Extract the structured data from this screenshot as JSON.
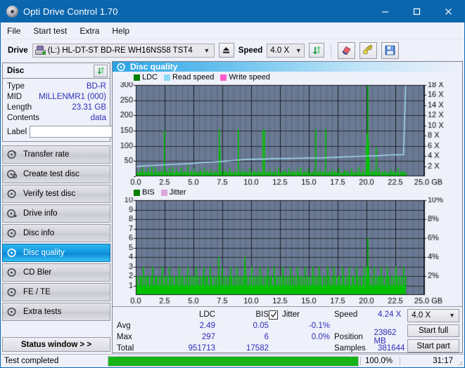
{
  "window": {
    "title": "Opti Drive Control 1.70",
    "icon": "disc-icon",
    "minimize": "minimize-icon",
    "maximize": "maximize-icon",
    "close": "close-icon"
  },
  "menu": {
    "items": [
      {
        "label": "File"
      },
      {
        "label": "Start test"
      },
      {
        "label": "Extra"
      },
      {
        "label": "Help"
      }
    ]
  },
  "toolbar": {
    "drive_label": "Drive",
    "drive_value": "(L:)  HL-DT-ST BD-RE  WH16NS58 TST4",
    "eject_icon": "eject-icon",
    "speed_label": "Speed",
    "speed_value": "4.0 X",
    "refresh_icon": "refresh-icon",
    "eraser_icon": "eraser-icon",
    "tools_icon": "wrench-icon",
    "save_icon": "save-icon"
  },
  "disc": {
    "title": "Disc",
    "refresh_icon": "refresh-icon",
    "rows": [
      {
        "key": "Type",
        "value": "BD-R"
      },
      {
        "key": "MID",
        "value": "MILLENMR1 (000)"
      },
      {
        "key": "Length",
        "value": "23.31 GB"
      },
      {
        "key": "Contents",
        "value": "data"
      }
    ],
    "label_key": "Label",
    "label_value": "",
    "label_placeholder": "",
    "disc_button_icon": "cd-icon"
  },
  "sidebar": {
    "items": [
      {
        "label": "Transfer rate",
        "icon": "disc-test-icon",
        "active": false
      },
      {
        "label": "Create test disc",
        "icon": "disc-burn-icon",
        "active": false
      },
      {
        "label": "Verify test disc",
        "icon": "disc-verify-icon",
        "active": false
      },
      {
        "label": "Drive info",
        "icon": "drive-info-icon",
        "active": false
      },
      {
        "label": "Disc info",
        "icon": "disc-info-icon",
        "active": false
      },
      {
        "label": "Disc quality",
        "icon": "disc-quality-icon",
        "active": true
      },
      {
        "label": "CD Bler",
        "icon": "cd-bler-icon",
        "active": false
      },
      {
        "label": "FE / TE",
        "icon": "fe-te-icon",
        "active": false
      },
      {
        "label": "Extra tests",
        "icon": "extra-tests-icon",
        "active": false
      }
    ],
    "status_window_label": "Status window > >"
  },
  "panel": {
    "title": "Disc quality",
    "icon": "disc-quality-icon"
  },
  "chart_data": [
    {
      "type": "line",
      "name": "ldc-chart",
      "title": "",
      "legend": [
        {
          "label": "LDC",
          "color": "#008000"
        },
        {
          "label": "Read speed",
          "color": "#8ed8f8"
        },
        {
          "label": "Write speed",
          "color": "#ff5ccc"
        }
      ],
      "legend_position": "top-left",
      "grid": true,
      "xlabel": "GB",
      "x": [
        0.0,
        2.5,
        5.0,
        7.5,
        10.0,
        12.5,
        15.0,
        17.5,
        20.0,
        22.5,
        25.0
      ],
      "xticklabels": [
        "0.0",
        "2.5",
        "5.0",
        "7.5",
        "10.0",
        "12.5",
        "15.0",
        "17.5",
        "20.0",
        "22.5",
        "25.0 GB"
      ],
      "xlim": [
        0,
        25
      ],
      "ylabel_left": "LDC",
      "yticks_left": [
        0,
        50,
        100,
        150,
        200,
        250,
        300
      ],
      "yticklabels_left": [
        "",
        "50",
        "100",
        "150",
        "200",
        "250",
        "300"
      ],
      "ylim_left": [
        0,
        300
      ],
      "ylabel_right": "Speed",
      "yticks_right": [
        2,
        4,
        6,
        8,
        10,
        12,
        14,
        16,
        18
      ],
      "yticklabels_right": [
        "2 X",
        "4 X",
        "6 X",
        "8 X",
        "10 X",
        "12 X",
        "14 X",
        "16 X",
        "18 X"
      ],
      "ylim_right": [
        0,
        18
      ],
      "series": [
        {
          "name": "LDC",
          "color": "#00c000",
          "kind": "impulse",
          "data_end_x": 23.4,
          "values": [
            8,
            14,
            6,
            10,
            22,
            7,
            12,
            9,
            30,
            11,
            7,
            18,
            9,
            13,
            6,
            26,
            10,
            8,
            15,
            34,
            9,
            6,
            12,
            28,
            7,
            11,
            19,
            8,
            14,
            6,
            9,
            22,
            13,
            7,
            150,
            12,
            8,
            18,
            10,
            6,
            27,
            9,
            14,
            7,
            11,
            31,
            8,
            12,
            9,
            23,
            7,
            16,
            10,
            6,
            13,
            28,
            9,
            7,
            18,
            11,
            6,
            14,
            9,
            35,
            8,
            12,
            7,
            19,
            10,
            6,
            24,
            8,
            13,
            9,
            7,
            16,
            11,
            6,
            22,
            8,
            14,
            7,
            10,
            27,
            9,
            6,
            12,
            18,
            8,
            11,
            7,
            23,
            9,
            6,
            14,
            10,
            7,
            19,
            8,
            12,
            6,
            155,
            90,
            9,
            14,
            7,
            22,
            10,
            6,
            18,
            9,
            13,
            7,
            11,
            26,
            8,
            6,
            15,
            9,
            12,
            7,
            19,
            10,
            6,
            155,
            14,
            8,
            11,
            7,
            23,
            9,
            6,
            18,
            12,
            8,
            14,
            7,
            10,
            27,
            9,
            6,
            13,
            8,
            19,
            11,
            7,
            16,
            10,
            6,
            22,
            9,
            14,
            7,
            11,
            152,
            8,
            153,
            10,
            6,
            18,
            9,
            13,
            7,
            24,
            11,
            6,
            15,
            8,
            12,
            7,
            19,
            9,
            6,
            28,
            10,
            14,
            7,
            11,
            17,
            8,
            6,
            21,
            9,
            13,
            7,
            10,
            26,
            8,
            6,
            16,
            11,
            7,
            19,
            9,
            12,
            6,
            23,
            8,
            14,
            7,
            10,
            30,
            9,
            6,
            13,
            18,
            8,
            11,
            7,
            25,
            10,
            6,
            15,
            9,
            12,
            7,
            20,
            8,
            6,
            154,
            11,
            14,
            7,
            9,
            22,
            6,
            12,
            18,
            8,
            10,
            7,
            155,
            13,
            9,
            6,
            16,
            11,
            7,
            24,
            8,
            12,
            6,
            19,
            9,
            14,
            7,
            10,
            28,
            8,
            6,
            13,
            11,
            9,
            7,
            22,
            16,
            6,
            18,
            10,
            8,
            7,
            12,
            26,
            9,
            6,
            14,
            11,
            7,
            19,
            8,
            10,
            6,
            30,
            9,
            13,
            7,
            11,
            23,
            8,
            6,
            100,
            140,
            297,
            120,
            60,
            9,
            14,
            7,
            22,
            10,
            6,
            18,
            95,
            13,
            7,
            11,
            26,
            8,
            6,
            15,
            9,
            12,
            7,
            19,
            10,
            6,
            14,
            8,
            11,
            7,
            23,
            9,
            6,
            18,
            12,
            8,
            14,
            7,
            10,
            27,
            9,
            6,
            13,
            8,
            19,
            11,
            7,
            16,
            10,
            6
          ]
        },
        {
          "name": "Read speed",
          "color": "#a8e2fa",
          "kind": "line",
          "points": [
            [
              0.0,
              1.9
            ],
            [
              0.5,
              2.0
            ],
            [
              1.2,
              2.1
            ],
            [
              2.0,
              2.2
            ],
            [
              2.9,
              2.3
            ],
            [
              3.8,
              2.4
            ],
            [
              4.7,
              2.5
            ],
            [
              5.6,
              2.7
            ],
            [
              6.5,
              2.8
            ],
            [
              7.4,
              2.9
            ],
            [
              8.3,
              3.1
            ],
            [
              9.2,
              3.25
            ],
            [
              10.1,
              3.35
            ],
            [
              11.0,
              3.4
            ],
            [
              12.0,
              3.5
            ],
            [
              13.0,
              3.5
            ],
            [
              14.0,
              3.55
            ],
            [
              15.0,
              3.6
            ],
            [
              16.0,
              3.62
            ],
            [
              17.0,
              3.7
            ],
            [
              18.0,
              3.8
            ],
            [
              19.0,
              3.9
            ],
            [
              20.0,
              4.0
            ],
            [
              21.0,
              4.05
            ],
            [
              22.0,
              4.2
            ],
            [
              23.2,
              4.25
            ],
            [
              23.4,
              18.0
            ]
          ]
        }
      ]
    },
    {
      "type": "line",
      "name": "bis-chart",
      "title": "",
      "legend": [
        {
          "label": "BIS",
          "color": "#008000"
        },
        {
          "label": "Jitter",
          "color": "#d9a8d9"
        }
      ],
      "legend_position": "top-left",
      "grid": true,
      "xlabel": "GB",
      "xticklabels": [
        "0.0",
        "2.5",
        "5.0",
        "7.5",
        "10.0",
        "12.5",
        "15.0",
        "17.5",
        "20.0",
        "22.5",
        "25.0 GB"
      ],
      "xlim": [
        0,
        25
      ],
      "ylabel_left": "BIS",
      "yticks_left": [
        1,
        2,
        3,
        4,
        5,
        6,
        7,
        8,
        9,
        10
      ],
      "yticklabels_left": [
        "1",
        "2",
        "3",
        "4",
        "5",
        "6",
        "7",
        "8",
        "9",
        "10"
      ],
      "ylim_left": [
        0,
        10
      ],
      "ylabel_right": "Jitter",
      "yticks_right": [
        2,
        4,
        6,
        8,
        10
      ],
      "yticklabels_right": [
        "2%",
        "4%",
        "6%",
        "8%",
        "10%"
      ],
      "ylim_right": [
        0,
        10
      ],
      "series": [
        {
          "name": "BIS",
          "color": "#00c000",
          "kind": "impulse",
          "data_end_x": 23.4,
          "baseline": 1,
          "values": [
            1,
            2,
            1,
            1,
            2,
            1,
            2,
            1,
            1,
            3,
            1,
            2,
            1,
            1,
            2,
            2,
            1,
            1,
            2,
            1,
            3,
            1,
            1,
            2,
            1,
            2,
            1,
            1,
            2,
            1,
            1,
            2,
            3,
            1,
            1,
            2,
            1,
            2,
            1,
            1,
            3,
            1,
            2,
            1,
            1,
            2,
            1,
            1,
            2,
            1,
            2,
            1,
            3,
            1,
            1,
            2,
            1,
            2,
            1,
            1,
            2,
            1,
            1,
            3,
            1,
            2,
            1,
            1,
            2,
            1,
            2,
            1,
            1,
            3,
            1,
            2,
            1,
            1,
            2,
            1,
            1,
            2,
            3,
            1,
            1,
            2,
            1,
            2,
            1,
            1,
            3,
            1,
            2,
            1,
            1,
            2,
            1,
            1,
            2,
            1,
            4,
            1,
            2,
            1,
            1,
            3,
            1,
            2,
            1,
            1,
            2,
            1,
            1,
            2,
            1,
            3,
            1,
            2,
            1,
            1,
            2,
            1,
            1,
            3,
            1,
            2,
            1,
            1,
            2,
            1,
            2,
            1,
            4,
            3,
            1,
            2,
            1,
            1,
            2,
            1,
            1,
            3,
            1,
            2,
            1,
            1,
            2,
            1,
            2,
            1,
            1,
            3,
            1,
            2,
            1,
            1,
            2,
            1,
            1,
            2,
            3,
            1,
            1,
            2,
            1,
            2,
            1,
            1,
            3,
            1,
            2,
            1,
            1,
            2,
            1,
            1,
            2,
            1,
            3,
            1,
            2,
            1,
            1,
            2,
            1,
            2,
            1,
            1,
            3,
            1,
            2,
            1,
            1,
            2,
            1,
            1,
            3,
            1,
            2,
            1,
            1,
            2,
            1,
            2,
            1,
            1,
            3,
            1,
            2,
            1,
            1,
            2,
            1,
            1,
            2,
            3,
            1,
            1,
            2,
            1,
            2,
            1,
            1,
            3,
            1,
            2,
            1,
            1,
            2,
            1,
            1,
            2,
            1,
            3,
            1,
            2,
            1,
            1,
            2,
            1,
            1,
            3,
            1,
            2,
            1,
            1,
            2,
            1,
            2,
            1,
            1,
            3,
            1,
            2,
            1,
            1,
            2,
            1,
            1,
            2,
            3,
            1,
            1,
            2,
            1,
            2,
            1,
            1,
            3,
            1,
            2,
            1,
            1,
            2,
            1,
            1,
            2,
            1,
            3,
            1,
            2,
            3,
            6,
            3,
            2,
            1,
            1,
            2,
            1,
            1,
            3,
            1,
            2,
            1,
            1,
            2,
            1,
            2,
            3,
            1,
            1,
            2,
            1,
            1,
            2,
            1,
            3,
            1,
            2,
            1,
            1,
            2,
            1,
            1,
            2,
            1,
            3,
            1,
            2,
            1,
            1,
            2,
            1,
            2,
            1,
            1,
            3,
            1,
            2,
            1
          ]
        }
      ]
    }
  ],
  "stats": {
    "col_headers": [
      "",
      "LDC",
      "BIS"
    ],
    "rows": [
      {
        "label": "Avg",
        "ldc": "2.49",
        "bis": "0.05"
      },
      {
        "label": "Max",
        "ldc": "297",
        "bis": "6"
      },
      {
        "label": "Total",
        "ldc": "951713",
        "bis": "17582"
      }
    ],
    "jitter": {
      "checked": true,
      "label": "Jitter",
      "avg": "-0.1%",
      "max": "0.0%",
      "total": ""
    },
    "measures": [
      {
        "key": "Speed",
        "value": "4.24 X"
      },
      {
        "key": "Position",
        "value": "23862 MB"
      },
      {
        "key": "Samples",
        "value": "381644"
      }
    ],
    "speed_select": "4.0 X",
    "start_full_label": "Start full",
    "start_part_label": "Start part"
  },
  "statusbar": {
    "text": "Test completed",
    "progress_percent": 100.0,
    "progress_label": "100.0%",
    "elapsed": "31:17"
  },
  "colors": {
    "titlebar": "#0c66ae",
    "accent": "#0f97e2",
    "plot_bg": "#6b7a94",
    "value_text": "#2e2eb4",
    "green": "#00c000",
    "progress": "#17b317"
  }
}
